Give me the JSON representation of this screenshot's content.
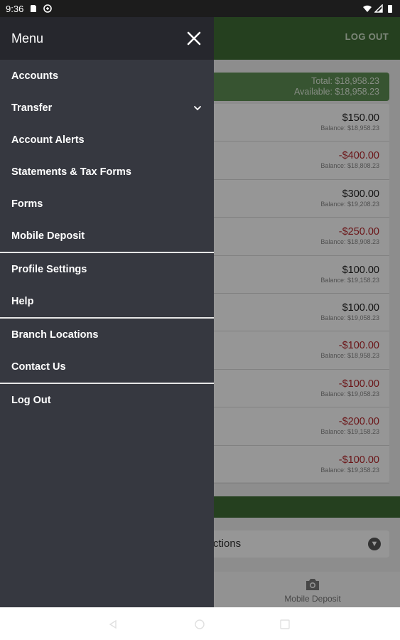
{
  "status_bar": {
    "time": "9:36"
  },
  "app": {
    "logout_label": "LOG OUT",
    "summary": {
      "total": "Total: $18,958.23",
      "available": "Available: $18,958.23"
    },
    "transactions": [
      {
        "amount": "$150.00",
        "balance": "Balance: $18,958.23",
        "negative": false
      },
      {
        "amount": "-$400.00",
        "balance": "Balance: $18,808.23",
        "negative": true
      },
      {
        "amount": "$300.00",
        "balance": "Balance: $19,208.23",
        "negative": false
      },
      {
        "amount": "-$250.00",
        "balance": "Balance: $18,908.23",
        "negative": true
      },
      {
        "amount": "$100.00",
        "balance": "Balance: $19,158.23",
        "negative": false
      },
      {
        "amount": "$100.00",
        "balance": "Balance: $19,058.23",
        "negative": false
      },
      {
        "amount": "-$100.00",
        "balance": "Balance: $18,958.23",
        "negative": true
      },
      {
        "amount": "-$100.00",
        "balance": "Balance: $19,058.23",
        "negative": true
      },
      {
        "amount": "-$200.00",
        "balance": "Balance: $19,158.23",
        "negative": true
      },
      {
        "amount": "-$100.00",
        "balance": "Balance: $19,358.23",
        "negative": true
      }
    ],
    "collapsible_label": "ctions",
    "bottom_nav": {
      "mobile_deposit": "Mobile Deposit"
    }
  },
  "drawer": {
    "title": "Menu",
    "items": [
      {
        "label": "Accounts"
      },
      {
        "label": "Transfer"
      },
      {
        "label": "Account Alerts"
      },
      {
        "label": "Statements & Tax Forms"
      },
      {
        "label": "Forms"
      },
      {
        "label": "Mobile Deposit"
      },
      {
        "label": "Profile Settings"
      },
      {
        "label": "Help"
      },
      {
        "label": "Branch Locations"
      },
      {
        "label": "Contact Us"
      },
      {
        "label": "Log Out"
      }
    ]
  },
  "colors": {
    "brand_green": "#3e6b35",
    "drawer_bg": "#363840",
    "drawer_header_bg": "#26272d",
    "negative": "#b3262a"
  }
}
